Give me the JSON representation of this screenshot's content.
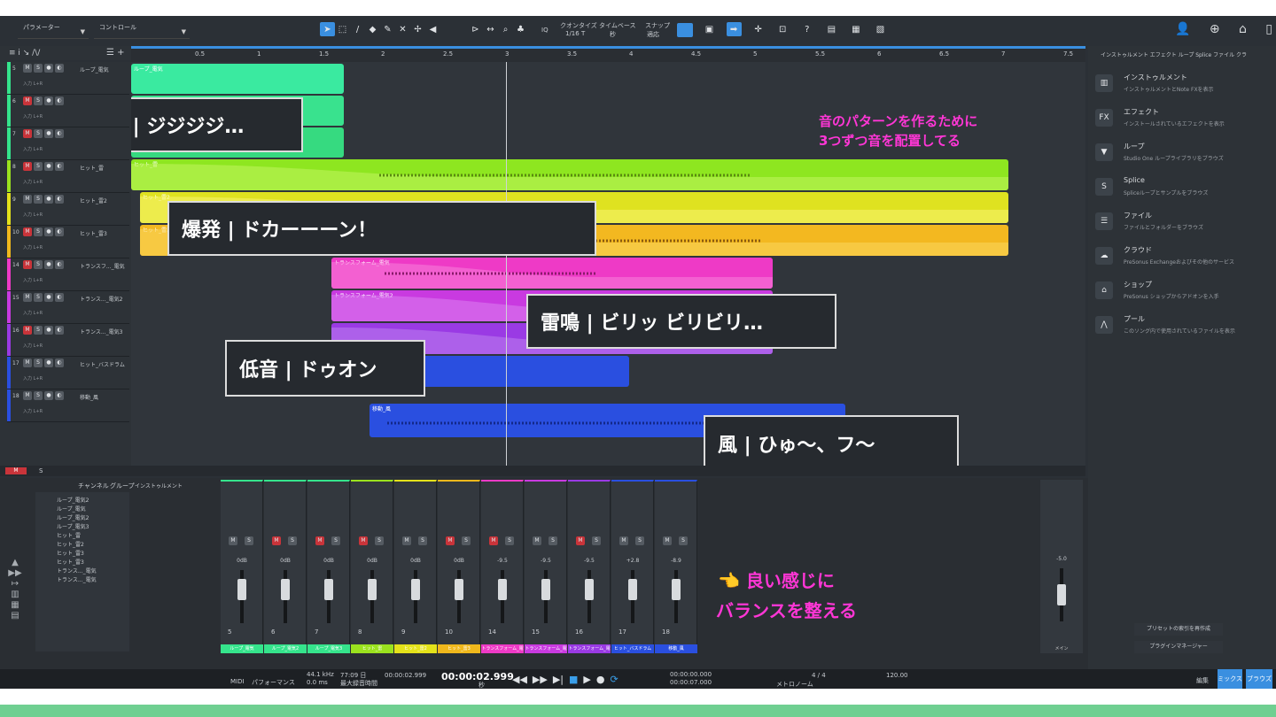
{
  "toolbar": {
    "param_label": "パラメーター",
    "control_label": "コントロール",
    "quantize_label": "クオンタイズ",
    "quantize_value": "1/16 T",
    "timebase_label": "タイムベース",
    "timebase_value": "秒",
    "snap_label": "スナップ",
    "snap_value": "適応",
    "iq_label": "IQ"
  },
  "ruler": [
    "0.5",
    "1",
    "1.5",
    "2",
    "2.5",
    "3",
    "3.5",
    "4",
    "4.5",
    "5",
    "5.5",
    "6",
    "6.5",
    "7",
    "7.5"
  ],
  "tracks": [
    {
      "num": "5",
      "name": "ループ_電気",
      "color": "#35e48c",
      "mute": false,
      "sub": "入力 L+R"
    },
    {
      "num": "6",
      "name": "",
      "color": "#35e48c",
      "mute": true,
      "sub": "入力 L+R"
    },
    {
      "num": "7",
      "name": "",
      "color": "#35e48c",
      "mute": true,
      "sub": "入力 L+R"
    },
    {
      "num": "8",
      "name": "ヒット_雷",
      "color": "#9be21e",
      "mute": true,
      "sub": "入力 L+R"
    },
    {
      "num": "9",
      "name": "ヒット_雷2",
      "color": "#e4e21a",
      "mute": false,
      "sub": "入力 L+R"
    },
    {
      "num": "10",
      "name": "ヒット_雷3",
      "color": "#f0b81c",
      "mute": true,
      "sub": "入力 L+R"
    },
    {
      "num": "14",
      "name": "トランスフ..._電気",
      "color": "#ee3ac6",
      "mute": true,
      "sub": "入力 L+R"
    },
    {
      "num": "15",
      "name": "トランス..._電気2",
      "color": "#c93ae0",
      "mute": false,
      "sub": "入力 L+R"
    },
    {
      "num": "16",
      "name": "トランス..._電気3",
      "color": "#9a3ae4",
      "mute": true,
      "sub": "入力 L+R"
    },
    {
      "num": "17",
      "name": "ヒット_バスドラム",
      "color": "#2a4fe0",
      "mute": false,
      "sub": "入力 L+R"
    },
    {
      "num": "18",
      "name": "移動_風",
      "color": "#2a4fe0",
      "mute": false,
      "sub": "入力 L+R"
    }
  ],
  "clips": {
    "loop": "ループ_電気",
    "hit": "ヒット_雷",
    "hit2": "ヒット_雷2",
    "hit3": "ヒット_雷3",
    "trans1": "トランスフォーム_電気",
    "trans2": "トランスフォーム_電気2",
    "wind": "移動_風"
  },
  "annotations": {
    "electric": "電気 | ジジジジ…",
    "explosion": "爆発 | ドカーーーン！",
    "thunder": "雷鳴 | ビリッ ビリビリ…",
    "bass": "低音 | ドゥオン",
    "wind": "風 | ひゅ〜、フ〜",
    "pattern_note_1": "音のパターンを作るために",
    "pattern_note_2": "3つずつ音を配置してる",
    "balance_1": "👈 良い感じに",
    "balance_2": "バランスを整える"
  },
  "browser": {
    "tabs": "インストゥルメント  エフェクト  ループ  Splice  ファイル  クラ",
    "items": [
      {
        "icon": "▥",
        "title": "インストゥルメント",
        "desc": "インストゥルメントとNote FXを表示"
      },
      {
        "icon": "FX",
        "title": "エフェクト",
        "desc": "インストールされているエフェクトを表示"
      },
      {
        "icon": "▼",
        "title": "ループ",
        "desc": "Studio One ループライブラリをブラウズ"
      },
      {
        "icon": "S",
        "title": "Splice",
        "desc": "Spliceループとサンプルをブラウズ"
      },
      {
        "icon": "☰",
        "title": "ファイル",
        "desc": "ファイルとフォルダーをブラウズ"
      },
      {
        "icon": "☁",
        "title": "クラウド",
        "desc": "PreSonus Exchangeおよびその他のサービス"
      },
      {
        "icon": "⌂",
        "title": "ショップ",
        "desc": "PreSonus ショップからアドオンを入手"
      },
      {
        "icon": "⋀",
        "title": "プール",
        "desc": "このソング内で使用されているファイルを表示"
      }
    ],
    "btn_recreate": "プリセットの索引を再作成",
    "btn_plugin": "プラグインマネージャー"
  },
  "console": {
    "header_channel": "チャンネル",
    "header_group": "グループ",
    "header_inst": "インストゥルメント",
    "channels": [
      {
        "num": "5",
        "vol": "0dB",
        "label": "ループ_電気",
        "color": "#35e48c",
        "mute": false
      },
      {
        "num": "6",
        "vol": "0dB",
        "label": "ループ_電気2",
        "color": "#35e48c",
        "mute": true
      },
      {
        "num": "7",
        "vol": "0dB",
        "label": "ループ_電気3",
        "color": "#35e48c",
        "mute": true
      },
      {
        "num": "8",
        "vol": "0dB",
        "label": "ヒット_雷",
        "color": "#9be21e",
        "mute": true
      },
      {
        "num": "9",
        "vol": "0dB",
        "label": "ヒット_雷2",
        "color": "#e4e21a",
        "mute": false
      },
      {
        "num": "10",
        "vol": "0dB",
        "label": "ヒット_雷3",
        "color": "#f0b81c",
        "mute": true
      },
      {
        "num": "14",
        "vol": "-9.5",
        "label": "トランスフォーム_電気",
        "color": "#ee3ac6",
        "mute": true
      },
      {
        "num": "15",
        "vol": "-9.5",
        "label": "トランスフォーム_電気2",
        "color": "#c93ae0",
        "mute": false
      },
      {
        "num": "16",
        "vol": "-9.5",
        "label": "トランスフォーム_電気3",
        "color": "#9a3ae4",
        "mute": true
      },
      {
        "num": "17",
        "vol": "+2.8",
        "label": "ヒット_バスドラム",
        "color": "#2a4fe0",
        "mute": false
      },
      {
        "num": "18",
        "vol": "-8.9",
        "label": "移動_風",
        "color": "#2a4fe0",
        "mute": false
      }
    ],
    "master_vol": "-5.0",
    "master_label": "メイン",
    "list": [
      "ループ_電気2",
      "ループ_電気",
      "ループ_電気2",
      "ループ_電気3",
      "ヒット_雷",
      "ヒット_雷2",
      "ヒット_雷3",
      "ヒット_雷3",
      "トランス..._電気",
      "トランス..._電気"
    ]
  },
  "transport": {
    "midi": "MIDI",
    "perf": "パフォーマンス",
    "samplerate": "44.1 kHz",
    "latency": "0.0 ms",
    "days": "77:09 日",
    "rec_time": "最大録音時間",
    "pos1": "00:00:02.999",
    "pos_main": "00:00:02.999",
    "unit": "秒",
    "loop_l": "00:00:00.000",
    "loop_r": "00:00:07.000",
    "signature": "4 / 4",
    "tempo": "120.00",
    "metronome": "メトロノーム",
    "view_edit": "編集",
    "view_mix": "ミックス",
    "view_browse": "ブラウズ"
  }
}
